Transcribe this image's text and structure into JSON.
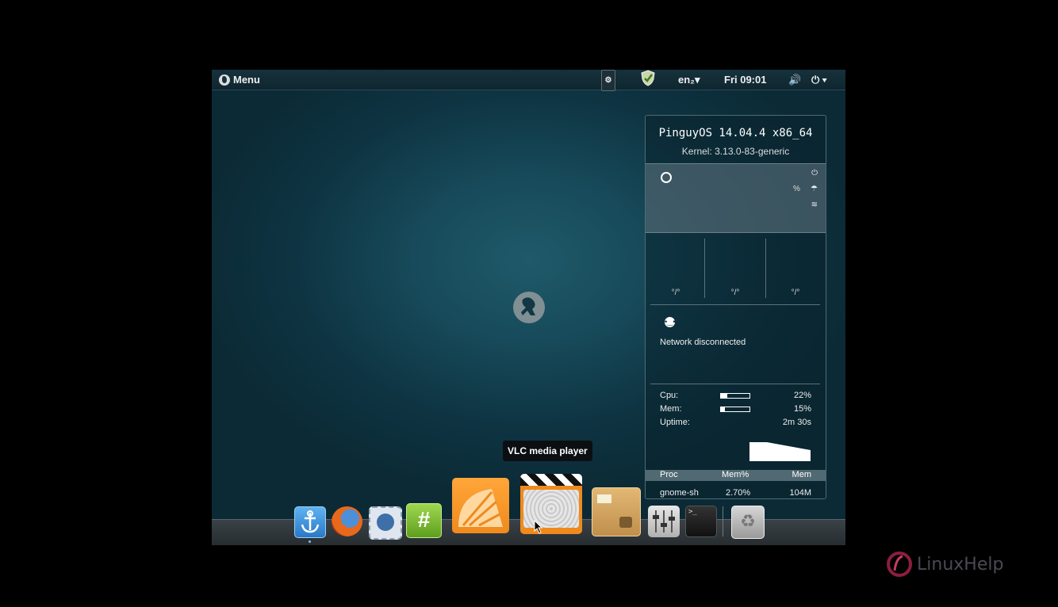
{
  "top_panel": {
    "menu_label": "Menu",
    "language": "en₂▾",
    "clock": "Fri 09:01",
    "volume_symbol": "🔊",
    "power_symbol": "⏻ ▾"
  },
  "conky": {
    "os_line": "PinguyOS 14.04.4 x86_64",
    "kernel_line": "Kernel: 3.13.0-83-generic",
    "weather": {
      "percent_symbol": "%"
    },
    "forecast": [
      "°/°",
      "°/°",
      "°/°"
    ],
    "network_status": "Network disconnected",
    "stats": {
      "cpu_label": "Cpu:",
      "cpu_value": "22%",
      "cpu_fraction": 0.22,
      "mem_label": "Mem:",
      "mem_value": "15%",
      "mem_fraction": 0.15,
      "uptime_label": "Uptime:",
      "uptime_value": "2m 30s"
    },
    "process_table": {
      "headers": [
        "Proc",
        "Mem%",
        "Mem"
      ],
      "rows": [
        [
          "gnome-sh",
          "2.70%",
          "104M"
        ]
      ]
    }
  },
  "tooltip": "VLC media player",
  "dock": {
    "items": [
      {
        "name": "docky-anchor"
      },
      {
        "name": "firefox"
      },
      {
        "name": "thunderbird"
      },
      {
        "name": "hexchat"
      },
      {
        "name": "clementine"
      },
      {
        "name": "vlc"
      },
      {
        "name": "archive-manager"
      },
      {
        "name": "system-settings"
      },
      {
        "name": "terminal"
      },
      {
        "name": "trash"
      }
    ]
  },
  "colors": {
    "desktop_bg": "#174a5a",
    "panel_bg": "#16323c",
    "accent_orange": "#f08a1c"
  }
}
